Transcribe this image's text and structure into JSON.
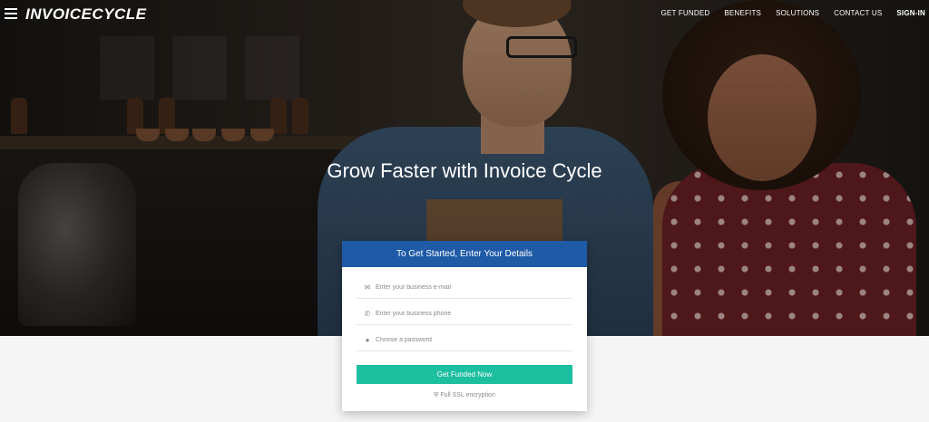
{
  "nav": {
    "logo": "INVOICECYCLE",
    "links": [
      "GET FUNDED",
      "BENEFITS",
      "SOLUTIONS",
      "CONTACT US",
      "SIGN-IN"
    ]
  },
  "hero": {
    "headline": "Grow Faster with Invoice Cycle"
  },
  "form": {
    "header": "To Get Started, Enter Your Details",
    "email_placeholder": "Enter your business e-mail",
    "phone_placeholder": "Enter your business phone",
    "password_placeholder": "Choose a password",
    "submit_label": "Get Funded Now",
    "ssl_note": "Full SSL encryption"
  },
  "colors": {
    "header_blue": "#1f5aa7",
    "button_teal": "#1dbfa1"
  },
  "icons": [
    "menu-icon",
    "envelope-icon",
    "phone-icon",
    "lock-icon",
    "shield-icon"
  ]
}
